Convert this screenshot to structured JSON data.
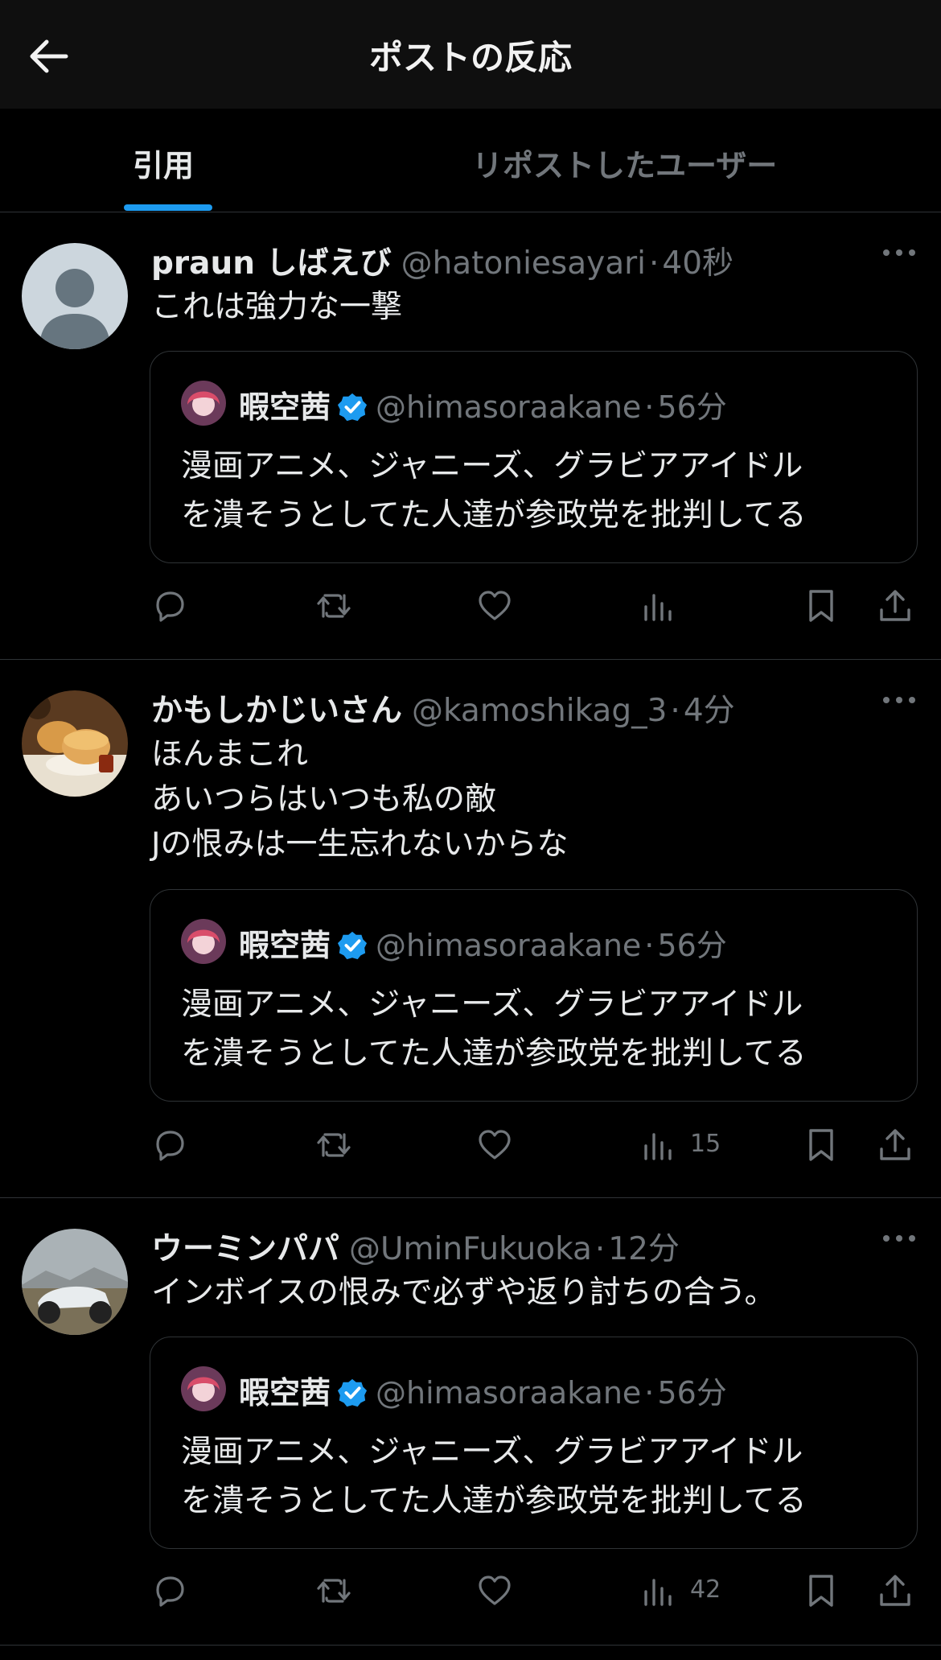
{
  "header": {
    "title": "ポストの反応",
    "back_icon": "arrow-left-icon"
  },
  "tabs": [
    {
      "label": "引用",
      "active": true
    },
    {
      "label": "リポストしたユーザー",
      "active": false
    }
  ],
  "colors": {
    "accent": "#1d9bf0",
    "muted": "#71767b",
    "background": "#000000",
    "border": "#2f3336"
  },
  "quoted": {
    "name": "暇空茜",
    "handle": "@himasoraakane",
    "time": "56分",
    "lines": [
      "漫画アニメ、ジャニーズ、グラビアアイドル",
      "を潰そうとしてた人達が参政党を批判してる"
    ]
  },
  "posts": [
    {
      "name": "praun しばえび",
      "handle": "@hatoniesayari",
      "time": "40秒",
      "lines": [
        "これは強力な一撃"
      ],
      "views": ""
    },
    {
      "name": "かもしかじいさん",
      "handle": "@kamoshikag_3",
      "time": "4分",
      "lines": [
        "ほんまこれ",
        "あいつらはいつも私の敵",
        "Jの恨みは一生忘れないからな"
      ],
      "views": "15"
    },
    {
      "name": "ウーミンパパ",
      "handle": "@UminFukuoka",
      "time": "12分",
      "lines": [
        "インボイスの恨みで必ずや返り討ちの合う。"
      ],
      "views": "42"
    }
  ],
  "sep": "·"
}
